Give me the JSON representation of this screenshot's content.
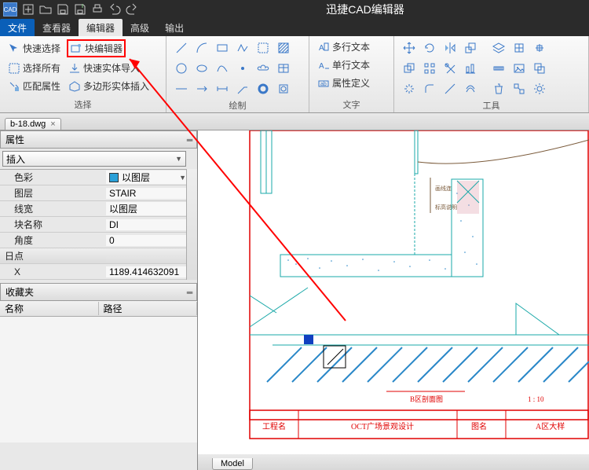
{
  "app": {
    "title": "迅捷CAD编辑器",
    "logo_text": "CAD"
  },
  "menus": {
    "file": "文件",
    "viewer": "查看器",
    "editor": "编辑器",
    "advanced": "高级",
    "output": "输出"
  },
  "ribbon": {
    "select": {
      "quick_select": "快速选择",
      "block_editor": "块编辑器",
      "select_all": "选择所有",
      "quick_entity_import": "快速实体导入",
      "match_props": "匹配属性",
      "poly_entity_insert": "多边形实体插入",
      "label": "选择"
    },
    "draw": {
      "label": "绘制"
    },
    "text": {
      "mtext": "多行文本",
      "stext": "单行文本",
      "attdef": "属性定义",
      "label": "文字"
    },
    "tools": {
      "label": "工具"
    }
  },
  "doc": {
    "tab_name": "b-18.dwg"
  },
  "prop_panel": {
    "title": "属性",
    "insert_dropdown": "插入",
    "rows": {
      "color_k": "色彩",
      "color_v": "以图层",
      "layer_k": "图层",
      "layer_v": "STAIR",
      "lw_k": "线宽",
      "lw_v": "以图层",
      "block_k": "块名称",
      "block_v": "DI",
      "angle_k": "角度",
      "angle_v": "0",
      "section": "日点",
      "x_k": "X",
      "x_v": "1189.414632091"
    }
  },
  "fav_panel": {
    "title": "收藏夹",
    "col_name": "名称",
    "col_path": "路径"
  },
  "bottom_tabs": {
    "model": "Model"
  },
  "canvas": {
    "titleblock": {
      "project_name_label": "工程名",
      "project_desc": "OCT广场景观设计",
      "drawing_label": "图名",
      "area_label": "A区大样",
      "section_label": "B区剖面图",
      "scale": "1 : 10"
    }
  }
}
